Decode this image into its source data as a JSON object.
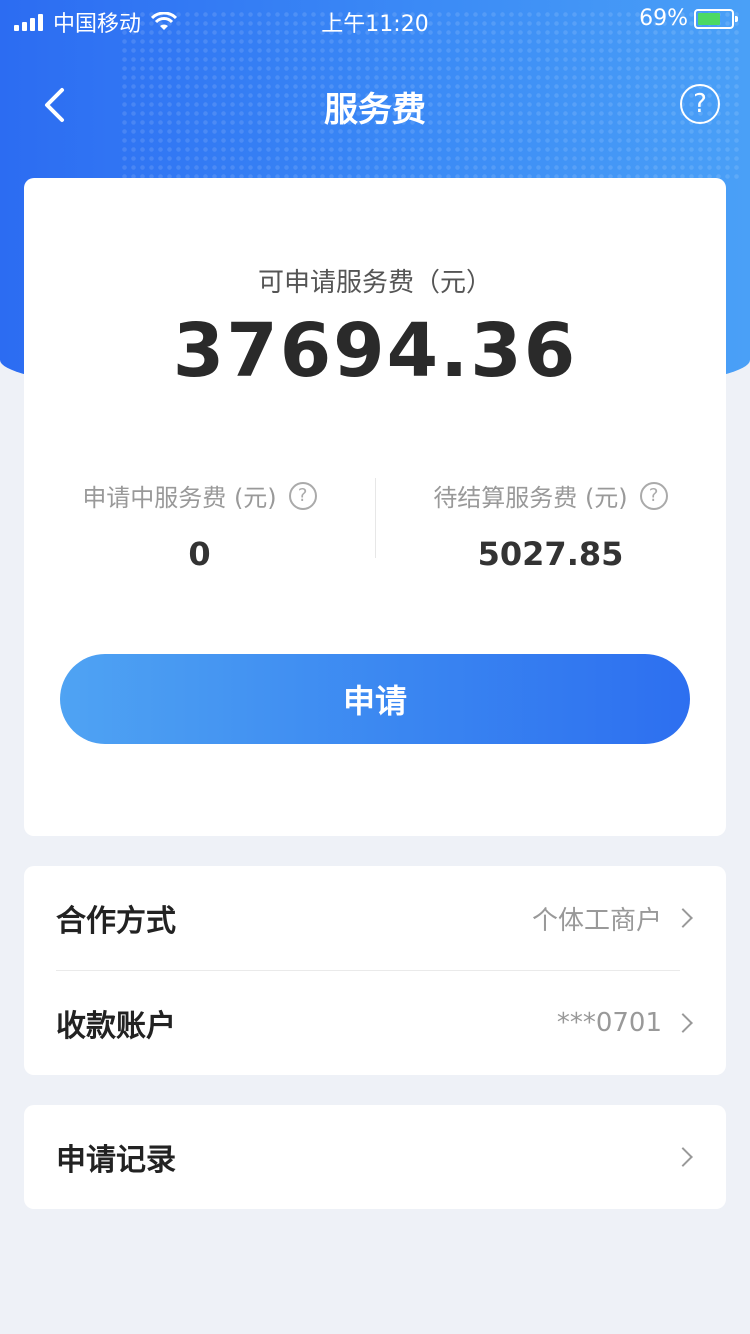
{
  "status_bar": {
    "carrier": "中国移动",
    "time": "上午11:20",
    "battery_percent": "69%",
    "battery_level": 0.69
  },
  "nav": {
    "title": "服务费",
    "help_glyph": "?"
  },
  "summary": {
    "available_label": "可申请服务费（元）",
    "available_amount": "37694.36",
    "pending_label": "申请中服务费 (元)",
    "pending_value": "0",
    "unsettled_label": "待结算服务费 (元)",
    "unsettled_value": "5027.85",
    "help_glyph": "?"
  },
  "apply_button": {
    "label": "申请"
  },
  "settings": [
    {
      "key": "合作方式",
      "value": "个体工商户"
    },
    {
      "key": "收款账户",
      "value": "***0701"
    }
  ],
  "records": {
    "label": "申请记录"
  },
  "colors": {
    "header_gradient_start": "#2c6cf2",
    "header_gradient_end": "#4aa0f7",
    "button_gradient_start": "#4fa3f3",
    "button_gradient_end": "#2d6ff0",
    "page_background": "#eef1f7",
    "battery_fill": "#4cd964"
  },
  "icons": [
    "back-chevron-icon",
    "help-circle-icon",
    "question-circle-icon",
    "chevron-right-icon",
    "signal-icon",
    "wifi-icon",
    "battery-icon"
  ]
}
